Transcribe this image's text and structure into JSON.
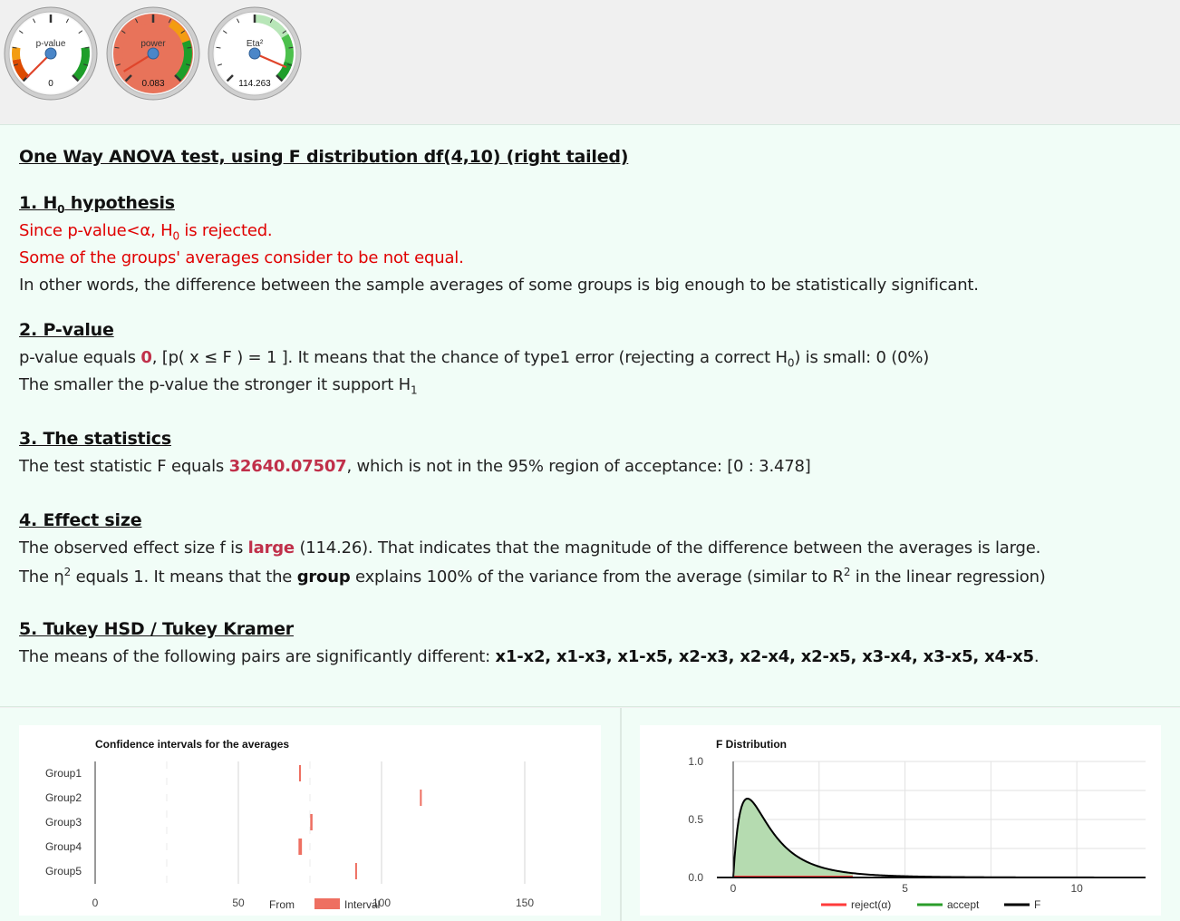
{
  "gauges": [
    {
      "label": "p-value",
      "value_text": "0",
      "needle_fraction": 0.0,
      "color": "#ffffff"
    },
    {
      "label": "power",
      "value_text": "0.083",
      "needle_fraction": 0.05,
      "color": "#e8735a"
    },
    {
      "label": "Eta²",
      "value_text": "114.263",
      "needle_fraction": 0.92,
      "color": "#ffffff"
    }
  ],
  "report": {
    "title": "One Way ANOVA test, using F distribution df(4,10) (right tailed)",
    "s1": {
      "title_pre": "1. H",
      "title_sub": "0",
      "title_post": " hypothesis",
      "l1_pre": "Since p-value<α, H",
      "l1_sub": "0",
      "l1_post": " is rejected.",
      "l2": "Some of the groups' averages consider to be not equal.",
      "l3": "In other words, the difference between the sample averages of some groups is big enough to be statistically significant."
    },
    "s2": {
      "title": "2. P-value",
      "l1_pre": "p-value equals ",
      "l1_val": "0",
      "l1_mid": ", [p( x ≤ F ) = 1 ]. It means that the chance of type1 error (rejecting a correct H",
      "l1_sub": "0",
      "l1_post": ") is small: 0 (0%)",
      "l2_pre": "The smaller the p-value the stronger it support H",
      "l2_sub": "1"
    },
    "s3": {
      "title": "3. The statistics",
      "l1_pre": "The test statistic F equals ",
      "l1_val": "32640.07507",
      "l1_post": ", which is not in the 95% region of acceptance: [0 : 3.478]"
    },
    "s4": {
      "title": "4. Effect size",
      "l1_pre": "The observed effect size f is ",
      "l1_val": "large",
      "l1_post": " (114.26). That indicates that the magnitude of the difference between the averages is large.",
      "l2_pre": "The η",
      "l2_sup": "2",
      "l2_mid": " equals 1. It means that the ",
      "l2_bold": "group",
      "l2_mid2": " explains 100% of the variance from the average (similar to R",
      "l2_sup2": "2",
      "l2_post": " in the linear regression)"
    },
    "s5": {
      "title": "5. Tukey HSD / Tukey Kramer",
      "l1_pre": "The means of the following pairs are significantly different: ",
      "l1_pairs": "x1-x2, x1-x3, x1-x5, x2-x3, x2-x4, x2-x5, x3-x4, x3-x5, x4-x5",
      "l1_post": "."
    }
  },
  "colors": {
    "reject": "#ff3b3b",
    "accept": "#2a9d2a",
    "interval": "#ee6f61",
    "F": "#000000"
  },
  "chart_data": [
    {
      "type": "bar",
      "title": "Confidence intervals for the averages",
      "categories": [
        "Group1",
        "Group2",
        "Group3",
        "Group4",
        "Group5"
      ],
      "from": [
        71.2,
        113.4,
        75.1,
        71.0,
        90.8
      ],
      "interval": [
        0.6,
        0.5,
        0.8,
        1.2,
        0.6
      ],
      "xlim": [
        0,
        175
      ],
      "xticks": [
        0,
        50,
        100,
        150
      ],
      "legend": [
        "From",
        "Interval"
      ]
    },
    {
      "type": "area",
      "title": "F Distribution",
      "df1": 4,
      "df2": 10,
      "critical_value": 3.478,
      "xlim": [
        0,
        12
      ],
      "ylim": [
        0,
        1
      ],
      "xticks": [
        0,
        5,
        10
      ],
      "yticks": [
        "0.0",
        "0.5",
        "1.0"
      ],
      "legend": [
        "reject(α)",
        "accept",
        "F"
      ]
    }
  ]
}
